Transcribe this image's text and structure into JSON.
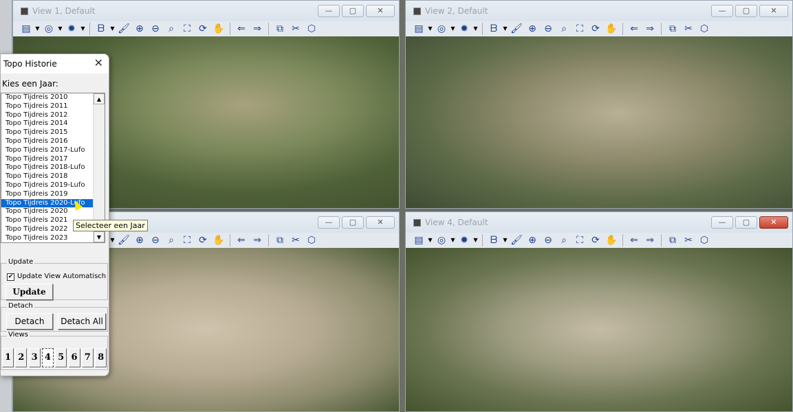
{
  "views": [
    {
      "title": "View 1, Default",
      "close_style": "normal"
    },
    {
      "title": "View 2, Default",
      "close_style": "normal"
    },
    {
      "title": "",
      "close_style": "normal"
    },
    {
      "title": "View 4, Default",
      "close_style": "active"
    }
  ],
  "window_buttons": {
    "minimize": "—",
    "maximize": "▢",
    "close": "✕"
  },
  "toolbar_icons": [
    {
      "name": "view-attributes-icon",
      "glyph": "▤"
    },
    {
      "name": "dropdown-arrow-icon",
      "glyph": "▼",
      "dd": true
    },
    {
      "name": "level-display-icon",
      "glyph": "◎"
    },
    {
      "name": "dropdown-arrow-icon",
      "glyph": "▼",
      "dd": true
    },
    {
      "name": "lighting-icon",
      "glyph": "✹"
    },
    {
      "name": "dropdown-arrow-icon",
      "glyph": "▼",
      "dd": true
    },
    {
      "name": "separator",
      "sep": true
    },
    {
      "name": "bing-maps-icon",
      "glyph": "ᗷ"
    },
    {
      "name": "dropdown-arrow-icon",
      "glyph": "▼",
      "dd": true
    },
    {
      "name": "brush-icon",
      "glyph": "🖌"
    },
    {
      "name": "zoom-in-icon",
      "glyph": "⊕"
    },
    {
      "name": "zoom-out-icon",
      "glyph": "⊖"
    },
    {
      "name": "window-area-icon",
      "glyph": "⌕"
    },
    {
      "name": "fit-view-icon",
      "glyph": "⛶"
    },
    {
      "name": "rotate-view-icon",
      "glyph": "⟳"
    },
    {
      "name": "pan-hand-icon",
      "glyph": "✋"
    },
    {
      "name": "separator",
      "sep": true
    },
    {
      "name": "previous-view-icon",
      "glyph": "⇐"
    },
    {
      "name": "next-view-icon",
      "glyph": "⇒"
    },
    {
      "name": "separator",
      "sep": true
    },
    {
      "name": "copy-view-icon",
      "glyph": "⧉"
    },
    {
      "name": "clip-volume-icon",
      "glyph": "✂"
    },
    {
      "name": "clip-mask-icon",
      "glyph": "⬡"
    }
  ],
  "dialog": {
    "title": "Topo Historie",
    "close": "✕",
    "list_label": "Kies een Jaar:",
    "years": [
      "Topo Tijdreis 2010",
      "Topo Tijdreis 2011",
      "Topo Tijdreis 2012",
      "Topo Tijdreis 2014",
      "Topo Tijdreis 2015",
      "Topo Tijdreis 2016",
      "Topo Tijdreis 2017-Lufo",
      "Topo Tijdreis 2017",
      "Topo Tijdreis 2018-Lufo",
      "Topo Tijdreis 2018",
      "Topo Tijdreis 2019-Lufo",
      "Topo Tijdreis 2019",
      "Topo Tijdreis 2020-Lufo",
      "Topo Tijdreis 2020",
      "Topo Tijdreis 2021",
      "Topo Tijdreis 2022",
      "Topo Tijdreis 2023"
    ],
    "selected_year": "Topo Tijdreis 2020-Lufo",
    "scroll_up": "▲",
    "scroll_down": "▼",
    "tooltip": "Selecteer een Jaar",
    "update_group": "Update",
    "auto_update_label": "Update View Automatisch",
    "auto_update_checked": true,
    "check_mark": "✔",
    "update_button": "Update",
    "detach_group": "Detach",
    "detach_button": "Detach",
    "detach_all_button": "Detach All",
    "views_group": "Views",
    "view_buttons": [
      "1",
      "2",
      "3",
      "4",
      "5",
      "6",
      "7",
      "8"
    ],
    "active_view": "4"
  }
}
